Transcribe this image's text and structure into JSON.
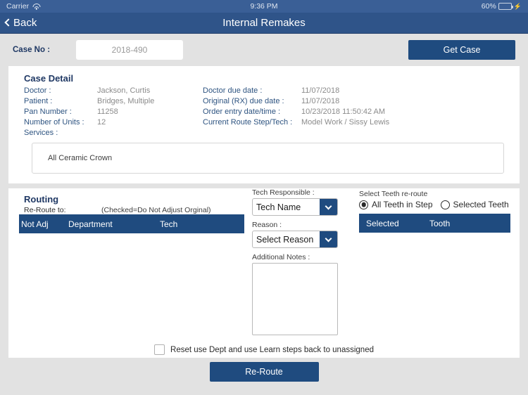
{
  "status_bar": {
    "carrier": "Carrier",
    "wifi_icon": "wifi-icon",
    "time": "9:36 PM",
    "battery_percent": "60%",
    "battery_level": 60,
    "charging_icon": "lightning-bolt-icon"
  },
  "nav": {
    "back_label": "Back",
    "back_icon": "chevron-left-icon",
    "title": "Internal Remakes"
  },
  "search": {
    "case_no_label": "Case No :",
    "case_no_value": "2018-490",
    "case_no_placeholder": "2018-490",
    "get_case_label": "Get Case"
  },
  "case_detail": {
    "title": "Case Detail",
    "rows": [
      {
        "left_label": "Doctor :",
        "left_value": "Jackson, Curtis",
        "right_label": "Doctor due date :",
        "right_value": "11/07/2018"
      },
      {
        "left_label": "Patient :",
        "left_value": "Bridges, Multiple",
        "right_label": "Original (RX) due date :",
        "right_value": "11/07/2018"
      },
      {
        "left_label": "Pan Number :",
        "left_value": "11258",
        "right_label": "Order entry date/time :",
        "right_value": "10/23/2018 11:50:42 AM"
      },
      {
        "left_label": "Number of Units :",
        "left_value": "12",
        "right_label": "Current Route Step/Tech :",
        "right_value": "Model Work / Sissy Lewis"
      },
      {
        "left_label": "Services :",
        "left_value": "",
        "right_label": "",
        "right_value": ""
      }
    ],
    "services_value": "All Ceramic Crown"
  },
  "routing": {
    "title": "Routing",
    "reroute_to_label": "Re-Route to:",
    "checked_note": "(Checked=Do Not Adjust Orginal)",
    "table_headers": {
      "not_adj": "Not Adj",
      "department": "Department",
      "tech": "Tech"
    },
    "tech_responsible_label": "Tech Responsible :",
    "tech_responsible_value": "Tech Name",
    "reason_label": "Reason :",
    "reason_value": "Select Reason",
    "additional_notes_label": "Additional Notes :",
    "additional_notes_value": "",
    "teeth": {
      "section_label": "Select Teeth re-route",
      "option_all": "All Teeth in Step",
      "option_selected": "Selected Teeth",
      "selected_option": "All Teeth in Step",
      "table_headers": {
        "selected": "Selected",
        "tooth": "Tooth"
      }
    },
    "reset_checkbox_label": "Reset use Dept and use Learn steps back to unassigned",
    "reset_checkbox_checked": false
  },
  "footer": {
    "reroute_button_label": "Re-Route"
  },
  "colors": {
    "nav_blue": "#2f5489",
    "status_blue": "#3a5f96",
    "accent_blue": "#1f4b7f",
    "label_blue": "#2e5481",
    "title_blue": "#1f3864",
    "page_bg": "#e2e2e2",
    "battery_green": "#4cd964"
  }
}
